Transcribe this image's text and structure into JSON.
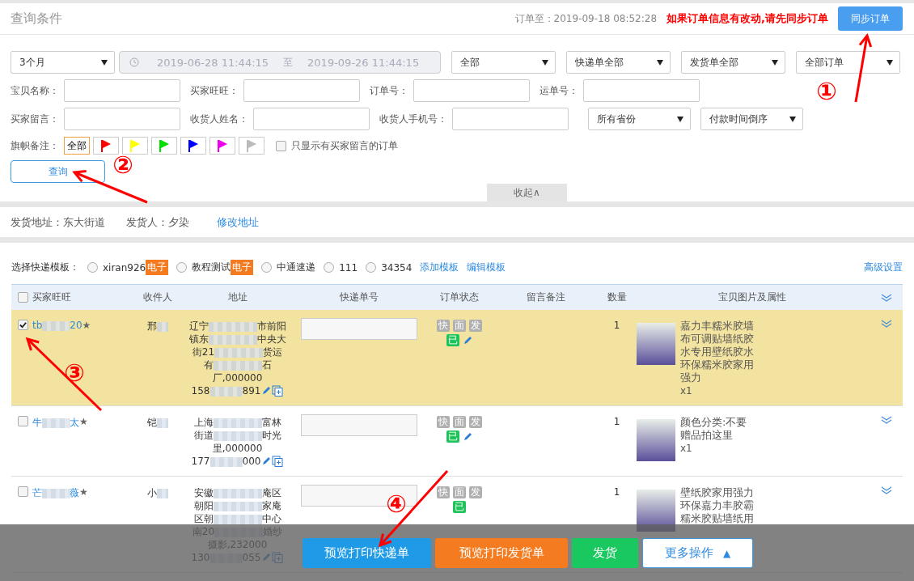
{
  "header": {
    "title": "查询条件",
    "sync_info": "订单至：2019-09-18 08:52:28",
    "notice": "如果订单信息有改动,请先同步订单",
    "sync_button": "同步订单"
  },
  "filters": {
    "period": {
      "value": "3个月"
    },
    "date_range": {
      "start": "2019-06-28 11:44:15",
      "separator": "至",
      "end": "2019-09-26 11:44:15",
      "disabled": true
    },
    "selects": [
      {
        "value": "全部"
      },
      {
        "value": "快递单全部"
      },
      {
        "value": "发货单全部"
      },
      {
        "value": "全部订单"
      }
    ],
    "fields_row_1": [
      {
        "label": "宝贝名称："
      },
      {
        "label": "买家旺旺："
      },
      {
        "label": "订单号："
      },
      {
        "label": "运单号："
      }
    ],
    "fields_row_2": [
      {
        "label": "买家留言："
      },
      {
        "label": "收货人姓名："
      },
      {
        "label": "收货人手机号："
      }
    ],
    "sort_selects": [
      {
        "value": "所有省份"
      },
      {
        "value": "付款时间倒序"
      }
    ],
    "flag_filter": {
      "label": "旗帜备注：",
      "options": [
        {
          "kind": "all",
          "label": "全部",
          "selected": true
        },
        {
          "kind": "flag",
          "color": "#ff0000",
          "selected": false
        },
        {
          "kind": "flag",
          "color": "#ffff00",
          "selected": false
        },
        {
          "kind": "flag",
          "color": "#00dd00",
          "selected": false
        },
        {
          "kind": "flag",
          "color": "#0000ff",
          "selected": false
        },
        {
          "kind": "flag",
          "color": "#ee00ee",
          "selected": false
        },
        {
          "kind": "flag",
          "color": "#bbbbbb",
          "selected": false
        }
      ]
    },
    "message_only": {
      "label": "只显示有买家留言的订单",
      "checked": false
    },
    "query_button": "查询",
    "collapse_tab": "收起∧"
  },
  "shipping": {
    "address": "发货地址：东大街道",
    "sender": "发货人：夕染",
    "edit_link": "修改地址"
  },
  "templates": {
    "label": "选择快递模板：",
    "options": [
      {
        "name": "xiran926",
        "badge": "电子",
        "selected": false
      },
      {
        "name": "教程测试",
        "badge": "电子",
        "selected": false
      },
      {
        "name": "中通速递",
        "selected": false
      },
      {
        "name": "111",
        "selected": false
      },
      {
        "name": "34354",
        "selected": false
      }
    ],
    "links": [
      "添加模板",
      "编辑模板"
    ],
    "advanced_link": "高级设置"
  },
  "table": {
    "select_all_checked": false,
    "columns": [
      "买家旺旺",
      "收件人",
      "地址",
      "快递单号",
      "订单状态",
      "留言备注",
      "数量",
      "宝贝图片及属性"
    ],
    "rows": [
      {
        "checked": true,
        "buyer": {
          "start": "tb",
          "end": "20",
          "star": "★"
        },
        "recipient": "邢",
        "address_lines": [
          {
            "a": "辽宁",
            "b": "市前阳"
          },
          {
            "a": "镇东",
            "b": "中央大"
          },
          {
            "a": "街21",
            "b": "货运"
          },
          {
            "a": "有",
            "b": "石"
          },
          {
            "a": "厂,000000"
          }
        ],
        "phone": {
          "a": "158",
          "b": "891"
        },
        "status_tags": [
          {
            "label": "快",
            "kind": "pending"
          },
          {
            "label": "面",
            "kind": "pending"
          },
          {
            "label": "发",
            "kind": "pending"
          },
          {
            "label": "已",
            "kind": "done"
          }
        ],
        "editable": true,
        "quantity": "1",
        "product": "嘉力丰糯米胶墙布可调贴墙纸胶水专用壁纸胶水环保糯米胶家用强力",
        "product_count": "x1"
      },
      {
        "checked": false,
        "buyer": {
          "start": "牛",
          "end": "太",
          "star": "★"
        },
        "recipient": "铠",
        "address_lines": [
          {
            "a": "上海",
            "b": "富林"
          },
          {
            "a": "街道",
            "b": "时光"
          },
          {
            "a": "里,000000"
          }
        ],
        "phone": {
          "a": "177",
          "b": "000"
        },
        "status_tags": [
          {
            "label": "快",
            "kind": "pending"
          },
          {
            "label": "面",
            "kind": "pending"
          },
          {
            "label": "发",
            "kind": "pending"
          },
          {
            "label": "已",
            "kind": "done"
          }
        ],
        "editable": true,
        "quantity": "1",
        "product": "颜色分类:不要赠品拍这里",
        "product_count": "x1"
      },
      {
        "checked": false,
        "buyer": {
          "start": "芒",
          "end": "薇",
          "star": "★"
        },
        "recipient": "小",
        "address_lines": [
          {
            "a": "安徽",
            "b": "庵区"
          },
          {
            "a": "朝阳",
            "b": "家庵"
          },
          {
            "a": "区朝",
            "b": "中心"
          },
          {
            "a": "南20",
            "b": "婚纱"
          },
          {
            "a": "摄影,232000"
          }
        ],
        "phone": {
          "a": "130",
          "b": "055"
        },
        "status_tags": [
          {
            "label": "快",
            "kind": "pending"
          },
          {
            "label": "面",
            "kind": "pending"
          },
          {
            "label": "发",
            "kind": "pending"
          },
          {
            "label": "已",
            "kind": "done"
          }
        ],
        "editable": false,
        "quantity": "1",
        "product": "壁纸胶家用强力环保嘉力丰胶霸糯米胶贴墙纸用"
      }
    ]
  },
  "bottom_bar": {
    "buttons": [
      {
        "kind": "primary",
        "label": "预览打印快递单"
      },
      {
        "kind": "warning",
        "label": "预览打印发货单"
      },
      {
        "kind": "success",
        "label": "发货"
      },
      {
        "kind": "outline",
        "label": "更多操作",
        "icon": "▲"
      }
    ]
  },
  "annotations": [
    {
      "number": "①"
    },
    {
      "number": "②"
    },
    {
      "number": "③"
    },
    {
      "number": "④"
    }
  ]
}
